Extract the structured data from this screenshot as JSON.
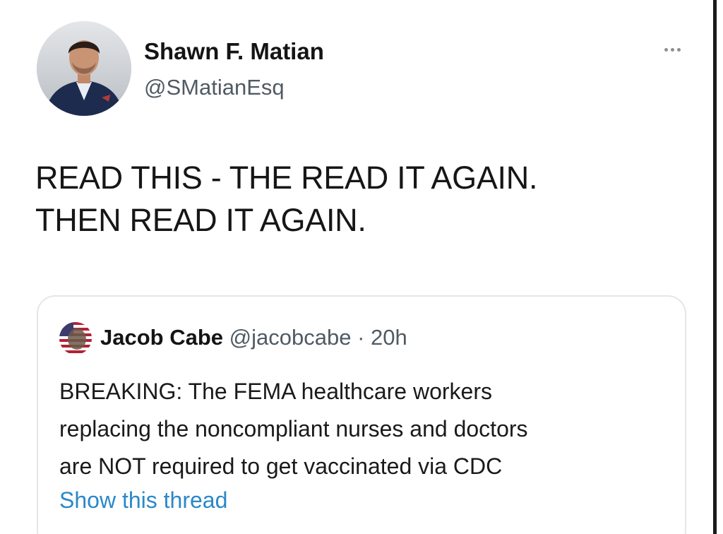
{
  "tweet": {
    "author_name": "Shawn F. Matian",
    "author_handle": "@SMatianEsq",
    "more_icon": "more-horizontal-icon",
    "text_lines": [
      "READ THIS - THE READ IT AGAIN.",
      "THEN READ IT AGAIN."
    ]
  },
  "quoted": {
    "author_name": "Jacob Cabe",
    "author_handle": "@jacobcabe",
    "separator": "·",
    "time": "20h",
    "text_lines": [
      "BREAKING: The FEMA healthcare workers",
      "replacing the noncompliant nurses and doctors",
      "are NOT required to get vaccinated via CDC"
    ],
    "show_thread_label": "Show this thread"
  },
  "colors": {
    "link": "#2b88c7",
    "handle": "#505a63",
    "card_border": "#e3e6ea"
  }
}
